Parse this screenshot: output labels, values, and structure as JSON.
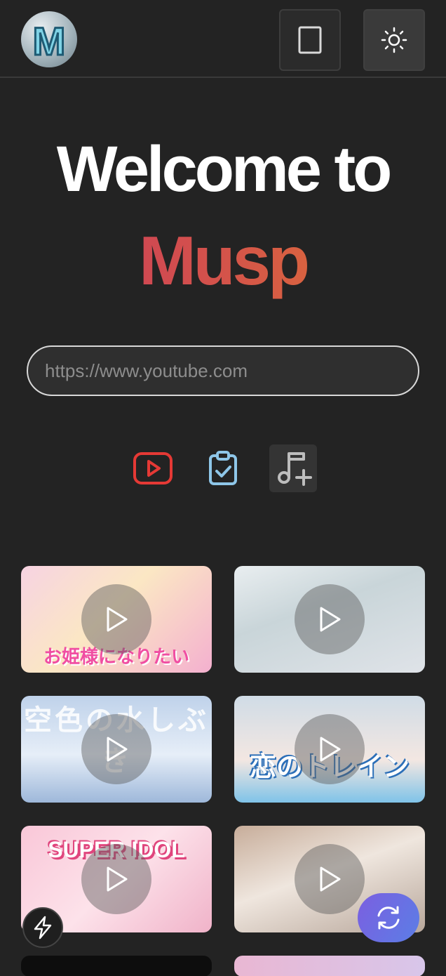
{
  "header": {
    "logo_letter": "M",
    "icons": [
      "mobile-view-icon",
      "sun-icon"
    ]
  },
  "hero": {
    "line1": "Welcome to",
    "line2": "Musp",
    "gradient_colors": [
      "#c8375f",
      "#e07a30"
    ]
  },
  "search": {
    "placeholder": "https://www.youtube.com",
    "value": ""
  },
  "tools": [
    {
      "name": "youtube-icon",
      "color": "#e53935"
    },
    {
      "name": "clipboard-check-icon",
      "color": "#8ec6e8"
    },
    {
      "name": "music-add-icon",
      "color": "#bdbdbd"
    }
  ],
  "thumbnails": [
    {
      "caption": "お姫様になりたい",
      "icon": "play-icon"
    },
    {
      "caption": "",
      "icon": "play-icon"
    },
    {
      "caption": "空色の水しぶき",
      "icon": "play-icon"
    },
    {
      "caption": "恋のトレイン",
      "icon": "play-icon"
    },
    {
      "caption": "SUPER IDOL",
      "icon": "play-icon"
    },
    {
      "caption": "",
      "icon": "play-icon"
    }
  ],
  "floating": {
    "left_icon": "lightning-icon",
    "right_icon": "refresh-icon",
    "accent": "#6b6fe4"
  }
}
